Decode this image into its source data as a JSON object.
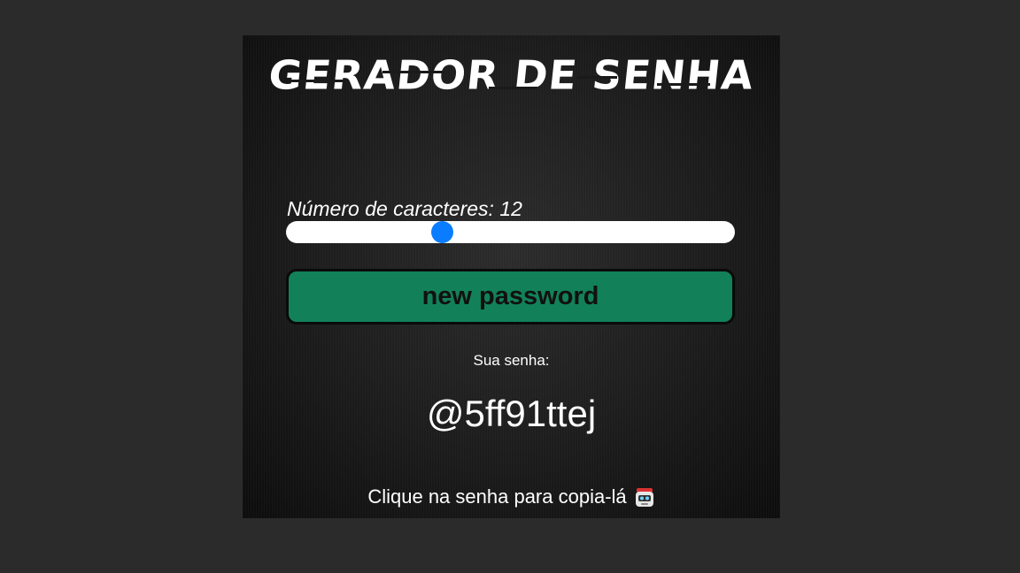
{
  "app": {
    "title": "GERADOR DE SENHA"
  },
  "length": {
    "label": "Número de caracteres: 12",
    "value": 12,
    "slider_fraction": 0.34
  },
  "generate_button": {
    "label": "new password"
  },
  "result": {
    "label": "Sua senha:",
    "password": "@5ff91ttej"
  },
  "hint": {
    "text": "Clique na senha para copia-lá",
    "icon": "robot-icon"
  },
  "colors": {
    "page_bg": "#2b2b2b",
    "button_bg": "#12815a",
    "slider_thumb": "#0a7cff"
  }
}
